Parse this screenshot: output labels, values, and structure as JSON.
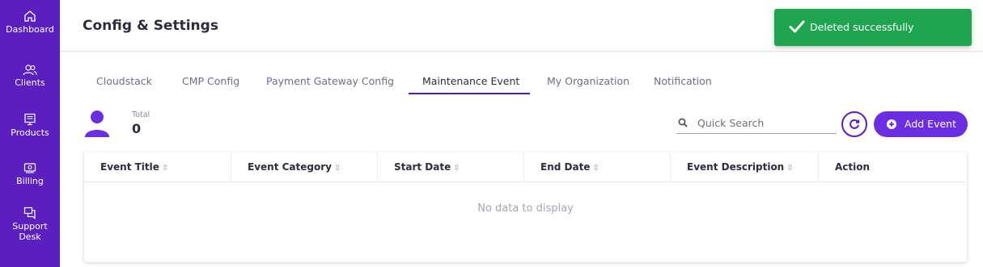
{
  "sidebar": {
    "items": [
      {
        "label": "Dashboard",
        "icon": "home-icon"
      },
      {
        "label": "Clients",
        "icon": "users-icon"
      },
      {
        "label": "Products",
        "icon": "monitor-icon"
      },
      {
        "label": "Billing",
        "icon": "billing-icon"
      },
      {
        "label": "Support",
        "label2": "Desk",
        "icon": "chat-icon"
      }
    ]
  },
  "header": {
    "title": "Config & Settings"
  },
  "toast": {
    "message": "Deleted successfully",
    "color": "#1fa54f"
  },
  "tabs": [
    {
      "label": "Cloudstack"
    },
    {
      "label": "CMP Config"
    },
    {
      "label": "Payment Gateway Config"
    },
    {
      "label": "Maintenance Event",
      "active": true
    },
    {
      "label": "My Organization"
    },
    {
      "label": "Notification"
    }
  ],
  "stats": {
    "total_label": "Total",
    "total_value": "0"
  },
  "search": {
    "placeholder": "Quick Search"
  },
  "actions": {
    "add_label": "Add Event"
  },
  "table": {
    "columns": [
      "Event Title",
      "Event Category",
      "Start Date",
      "End Date",
      "Event Description",
      "Action"
    ],
    "empty_text": "No data to display"
  },
  "colors": {
    "brand": "#5b1fbf",
    "accent": "#6a2ee0",
    "success": "#1fa54f"
  }
}
